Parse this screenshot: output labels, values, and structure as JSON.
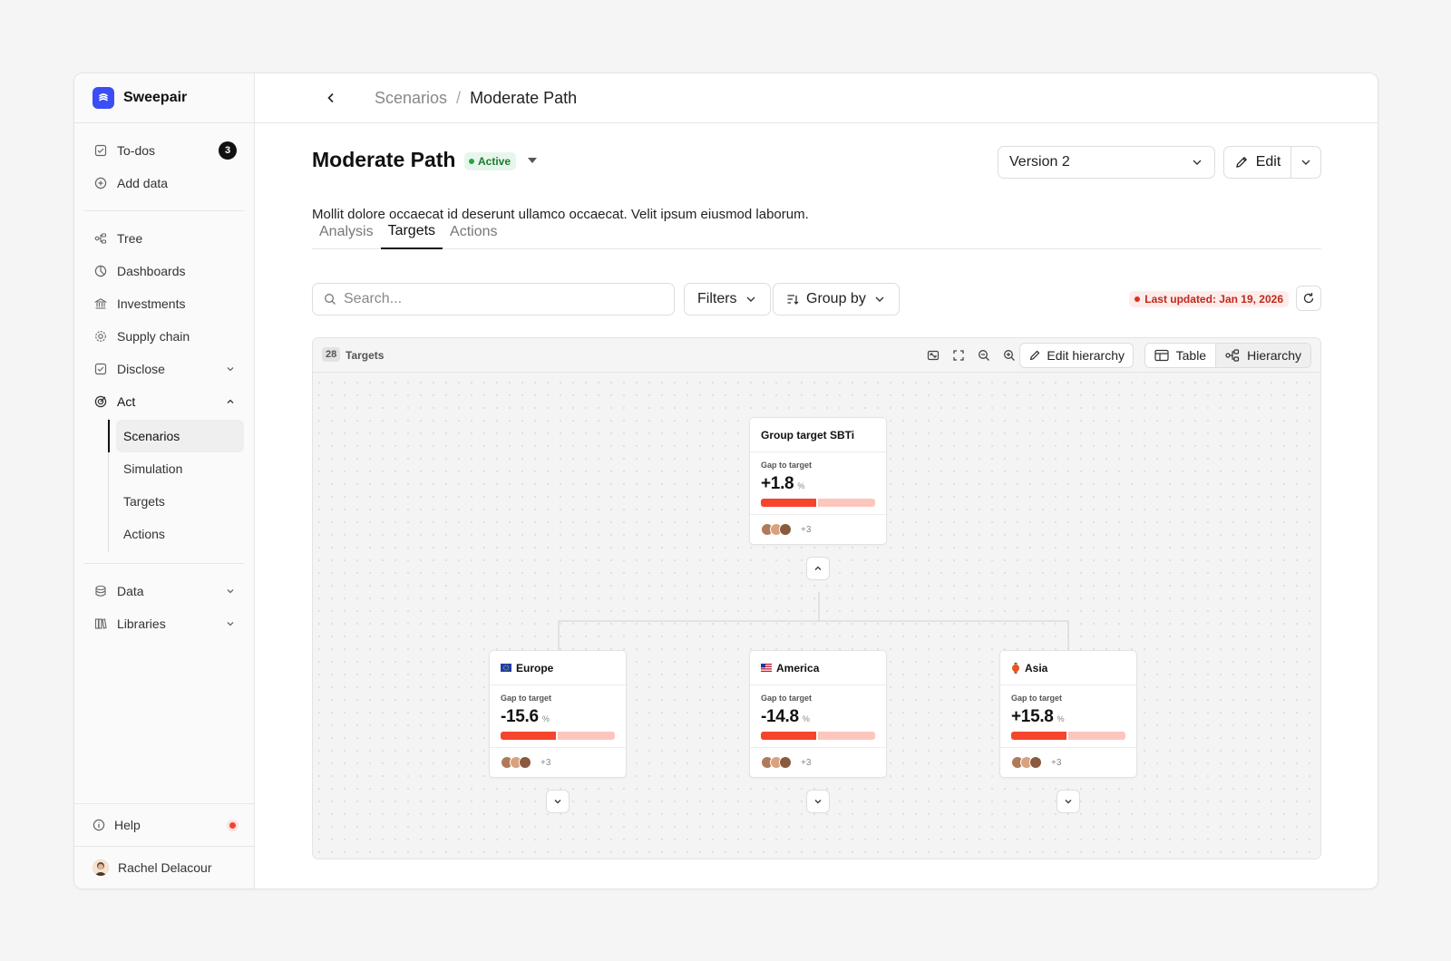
{
  "app": {
    "name": "Sweepair"
  },
  "sidebar": {
    "top_items": [
      {
        "label": "To-dos",
        "icon": "checkbox-icon",
        "badge": "3"
      },
      {
        "label": "Add data",
        "icon": "plus-circle-icon"
      }
    ],
    "main_items": [
      {
        "label": "Tree",
        "icon": "tree-icon"
      },
      {
        "label": "Dashboards",
        "icon": "pie-chart-icon"
      },
      {
        "label": "Investments",
        "icon": "bank-icon"
      },
      {
        "label": "Supply chain",
        "icon": "gear-icon"
      },
      {
        "label": "Disclose",
        "icon": "checkbox-icon"
      },
      {
        "label": "Act",
        "icon": "target-icon"
      }
    ],
    "act_subitems": [
      {
        "label": "Scenarios",
        "active": true
      },
      {
        "label": "Simulation"
      },
      {
        "label": "Targets"
      },
      {
        "label": "Actions"
      }
    ],
    "bottom_items": [
      {
        "label": "Data",
        "icon": "database-icon"
      },
      {
        "label": "Libraries",
        "icon": "library-icon"
      }
    ],
    "help_label": "Help",
    "user_name": "Rachel Delacour"
  },
  "breadcrumb": {
    "parent": "Scenarios",
    "separator": "/",
    "current": "Moderate Path"
  },
  "page": {
    "title": "Moderate Path",
    "status": "Active",
    "description": "Mollit dolore occaecat id deserunt ullamco occaecat. Velit ipsum eiusmod laborum.",
    "version": "Version 2",
    "edit_label": "Edit"
  },
  "tabs": [
    {
      "label": "Analysis"
    },
    {
      "label": "Targets",
      "active": true
    },
    {
      "label": "Actions"
    }
  ],
  "toolbar": {
    "search_placeholder": "Search...",
    "filters_label": "Filters",
    "groupby_label": "Group by",
    "last_updated": "Last updated: Jan 19, 2026"
  },
  "panel": {
    "count": "28",
    "count_label": "Targets",
    "edit_hierarchy_label": "Edit hierarchy",
    "table_label": "Table",
    "hierarchy_label": "Hierarchy"
  },
  "nodes": {
    "root": {
      "title": "Group target SBTi",
      "gap_label": "Gap to target",
      "value": "+1.8",
      "unit": "%",
      "progress": 0.5,
      "more": "+3"
    },
    "europe": {
      "title": "Europe",
      "gap_label": "Gap to target",
      "value": "-15.6",
      "unit": "%",
      "progress": 0.5,
      "more": "+3"
    },
    "america": {
      "title": "America",
      "gap_label": "Gap to target",
      "value": "-14.8",
      "unit": "%",
      "progress": 0.5,
      "more": "+3"
    },
    "asia": {
      "title": "Asia",
      "gap_label": "Gap to target",
      "value": "+15.8",
      "unit": "%",
      "progress": 0.5,
      "more": "+3"
    }
  },
  "colors": {
    "brand": "#3b4ef5",
    "bar_fill": "#f5452d",
    "bar_track": "#fcc6bd",
    "active_green": "#27a445",
    "alert_red": "#e0301e"
  }
}
